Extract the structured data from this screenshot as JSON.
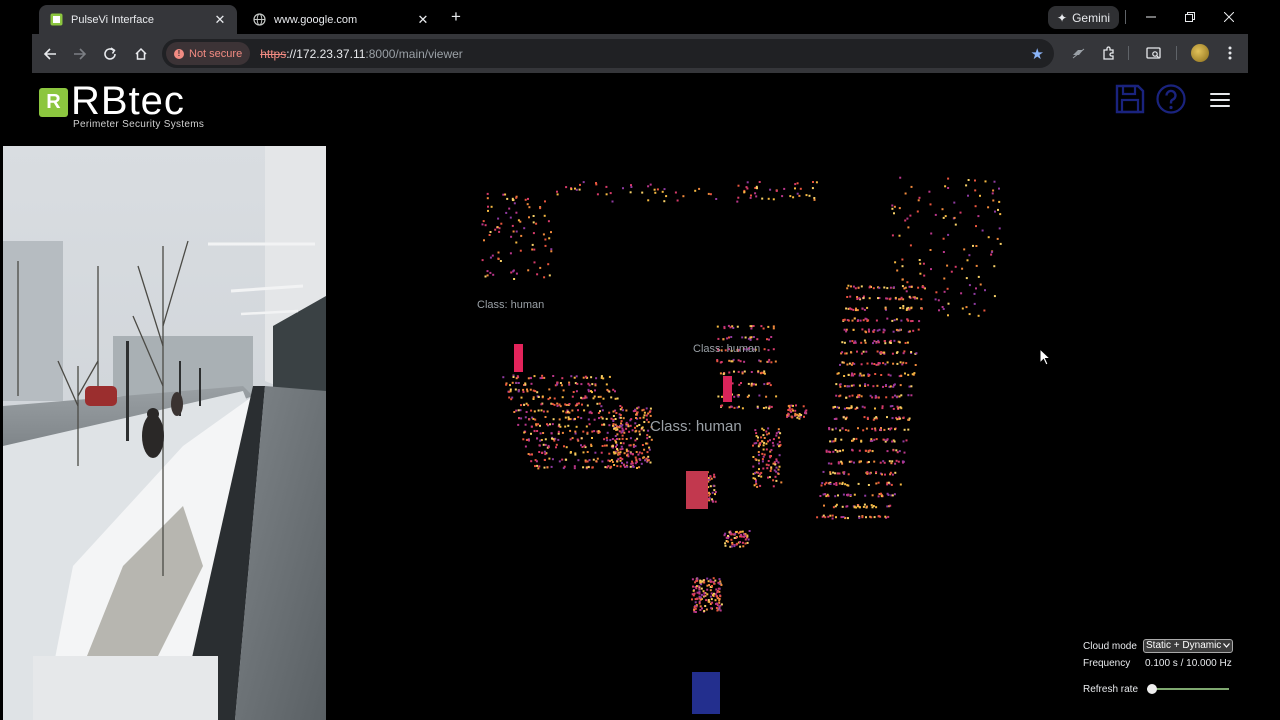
{
  "browser": {
    "tabs": [
      {
        "title": "PulseVi Interface",
        "active": true
      },
      {
        "title": "www.google.com",
        "active": false
      }
    ],
    "gemini_label": "Gemini",
    "security_label": "Not secure",
    "url": {
      "scheme": "https",
      "host": "://172.23.37.11",
      "path": ":8000/main/viewer"
    }
  },
  "app": {
    "logo": {
      "mark": "R",
      "name": "RBtec",
      "tagline": "Perimeter Security Systems"
    },
    "detections": [
      {
        "label": "Class: human"
      },
      {
        "label": "Class: human"
      },
      {
        "label": "Class: human"
      }
    ],
    "controls": {
      "cloud_mode_label": "Cloud mode",
      "cloud_mode_value": "Static + Dynamic",
      "frequency_label": "Frequency",
      "frequency_value": "0.100 s / 10.000 Hz",
      "refresh_rate_label": "Refresh rate",
      "refresh_rate_level": 0
    }
  },
  "colors": {
    "accent_blue": "#1a237e",
    "logo_green": "#8cc63f",
    "not_secure": "#f28b82",
    "bookmark": "#8ab4f8"
  }
}
